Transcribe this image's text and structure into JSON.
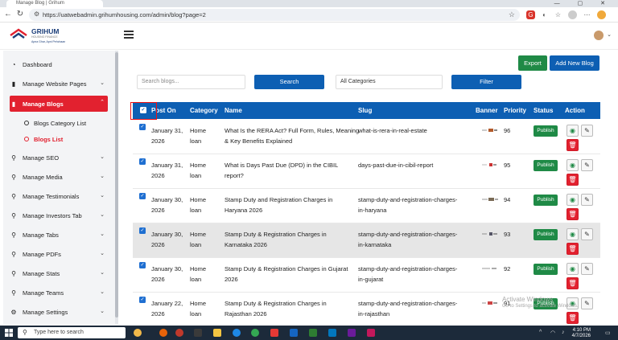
{
  "browser": {
    "tab_title": "Manage Blog | Grihum",
    "url": "https://uatwebadmin.grihumhousing.com/admin/blog?page=2"
  },
  "header": {
    "brand": "GRIHUM",
    "tagline1": "HOUSING FINANCE",
    "tagline2": "Apna Ghar, Apni Pehchaan"
  },
  "sidebar": {
    "items": [
      {
        "label": "Dashboard",
        "icon": "gauge-icon"
      },
      {
        "label": "Manage Website Pages",
        "icon": "file-icon"
      },
      {
        "label": "Manage Blogs",
        "icon": "file-icon",
        "active": true
      },
      {
        "label": "Manage SEO",
        "icon": "search-icon"
      },
      {
        "label": "Manage Media",
        "icon": "search-icon"
      },
      {
        "label": "Manage Testimonials",
        "icon": "search-icon"
      },
      {
        "label": "Manage Investors Tab",
        "icon": "search-icon"
      },
      {
        "label": "Manage Tabs",
        "icon": "search-icon"
      },
      {
        "label": "Manage PDFs",
        "icon": "search-icon"
      },
      {
        "label": "Manage Stats",
        "icon": "search-icon"
      },
      {
        "label": "Manage Teams",
        "icon": "search-icon"
      },
      {
        "label": "Manage Settings",
        "icon": "gear-icon"
      }
    ],
    "sub_items": [
      {
        "label": "Blogs Category List"
      },
      {
        "label": "Blogs List",
        "active": true
      }
    ]
  },
  "toolbar": {
    "export_label": "Export",
    "add_label": "Add New Blog",
    "search_placeholder": "Search blogs...",
    "search_label": "Search",
    "category_value": "All Categories",
    "filter_label": "Filter"
  },
  "table": {
    "headers": {
      "post_on": "Post On",
      "category": "Category",
      "name": "Name",
      "slug": "Slug",
      "banner": "Banner",
      "priority": "Priority",
      "status": "Status",
      "action": "Action"
    },
    "rows": [
      {
        "date1": "January 31,",
        "date2": "2026",
        "cat1": "Home",
        "cat2": "loan",
        "name1": "What Is the RERA Act? Full Form, Rules, Meaning",
        "name2": "& Key Benefits Explained",
        "slug1": "what-is-rera-in-real-estate",
        "slug2": "",
        "priority": "96",
        "status": "Publish"
      },
      {
        "date1": "January 31,",
        "date2": "2026",
        "cat1": "Home",
        "cat2": "loan",
        "name1": "What is Days Past Due (DPD) in the CIBIL",
        "name2": "report?",
        "slug1": "days-past-due-in-cibil-report",
        "slug2": "",
        "priority": "95",
        "status": "Publish"
      },
      {
        "date1": "January 30,",
        "date2": "2026",
        "cat1": "Home",
        "cat2": "loan",
        "name1": "Stamp Duty and Registration Charges in",
        "name2": "Haryana 2026",
        "slug1": "stamp-duty-and-registration-charges-",
        "slug2": "in-haryana",
        "priority": "94",
        "status": "Publish"
      },
      {
        "date1": "January 30,",
        "date2": "2026",
        "cat1": "Home",
        "cat2": "loan",
        "name1": "Stamp Duty & Registration Charges in",
        "name2": "Karnataka 2026",
        "slug1": "stamp-duty-and-registration-charges-",
        "slug2": "in-karnataka",
        "priority": "93",
        "status": "Publish"
      },
      {
        "date1": "January 30,",
        "date2": "2026",
        "cat1": "Home",
        "cat2": "loan",
        "name1": "Stamp Duty & Registration Charges in Gujarat",
        "name2": "2026",
        "slug1": "stamp-duty-and-registration-charges-",
        "slug2": "in-gujarat",
        "priority": "92",
        "status": "Publish"
      },
      {
        "date1": "January 22,",
        "date2": "2026",
        "cat1": "Home",
        "cat2": "loan",
        "name1": "Stamp Duty & Registration Charges in",
        "name2": "Rajasthan 2026",
        "slug1": "stamp-duty-and-registration-charges-",
        "slug2": "in-rajasthan",
        "priority": "91",
        "status": "Publish"
      }
    ]
  },
  "watermark": {
    "line1": "Activate Windows",
    "line2": "Go to Settings to activate Windows."
  },
  "taskbar": {
    "search_placeholder": "Type here to search",
    "time": "4:10 PM",
    "date": "4/7/2026"
  },
  "colors": {
    "brand_blue": "#0d5fb3",
    "active_red": "#e2212f",
    "publish_green": "#1f8a46"
  }
}
